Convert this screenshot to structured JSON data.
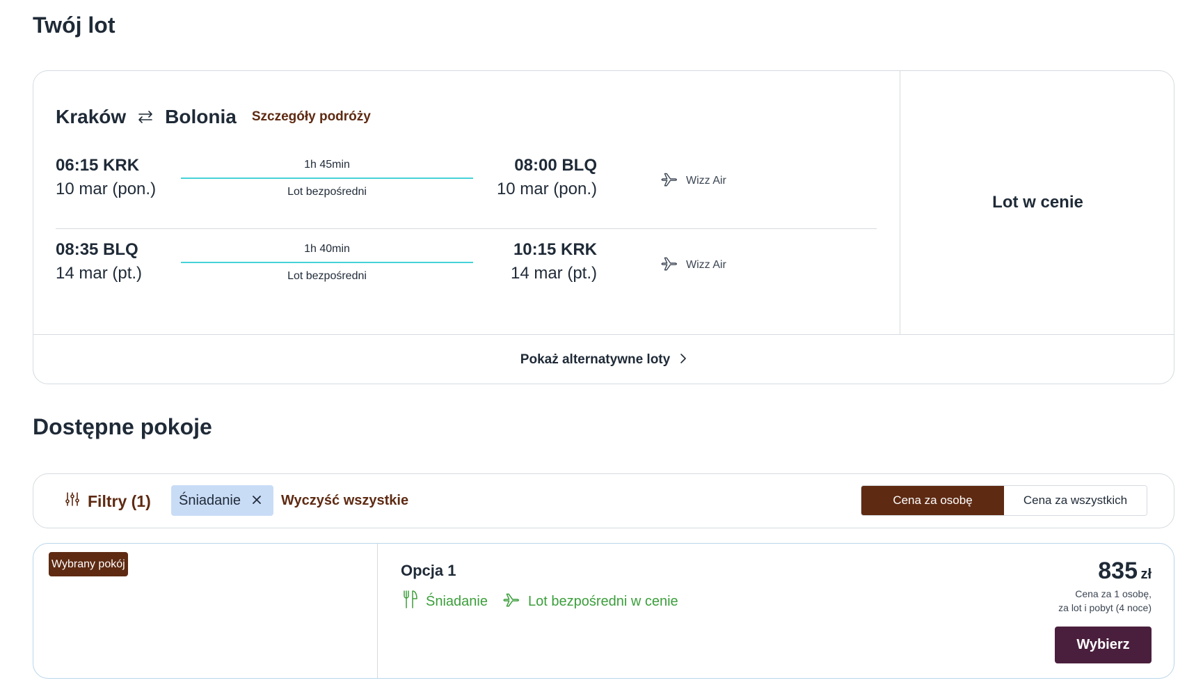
{
  "page": {
    "title": "Twój lot",
    "rooms_heading": "Dostępne pokoje"
  },
  "flight": {
    "origin": "Kraków",
    "destination": "Bolonia",
    "details_link": "Szczegóły podróży",
    "legs": [
      {
        "dep_time": "06:15 KRK",
        "dep_date": "10 mar (pon.)",
        "duration": "1h 45min",
        "type": "Lot bezpośredni",
        "arr_time": "08:00 BLQ",
        "arr_date": "10 mar (pon.)",
        "airline": "Wizz Air"
      },
      {
        "dep_time": "08:35 BLQ",
        "dep_date": "14 mar (pt.)",
        "duration": "1h 40min",
        "type": "Lot bezpośredni",
        "arr_time": "10:15 KRK",
        "arr_date": "14 mar (pt.)",
        "airline": "Wizz Air"
      }
    ],
    "price_label": "Lot w cenie",
    "alt_flights": "Pokaż alternatywne loty"
  },
  "filters": {
    "button": "Filtry (1)",
    "chips": [
      "Śniadanie"
    ],
    "clear_all": "Wyczyść wszystkie",
    "price_toggle": {
      "per_person": "Cena za osobę",
      "per_all": "Cena za wszystkich",
      "selected": "per_person"
    }
  },
  "room": {
    "badge": "Wybrany pokój",
    "title": "Opcja 1",
    "features": [
      "Śniadanie",
      "Lot bezpośredni w cenie"
    ],
    "price": "835",
    "currency": "zł",
    "price_note_1": "Cena za 1 osobę,",
    "price_note_2": "za lot i pobyt (4 noce)",
    "cta": "Wybierz"
  },
  "colors": {
    "brand": "#5e2a12",
    "cta": "#4a1f3d",
    "flight_line": "#45d2d8",
    "feature_green": "#3b9e3b",
    "chip_bg": "#c9dcf6"
  },
  "icons": [
    "swap-arrows-icon",
    "plane-icon",
    "chevron-right-icon",
    "sliders-icon",
    "close-icon",
    "cutlery-icon"
  ]
}
